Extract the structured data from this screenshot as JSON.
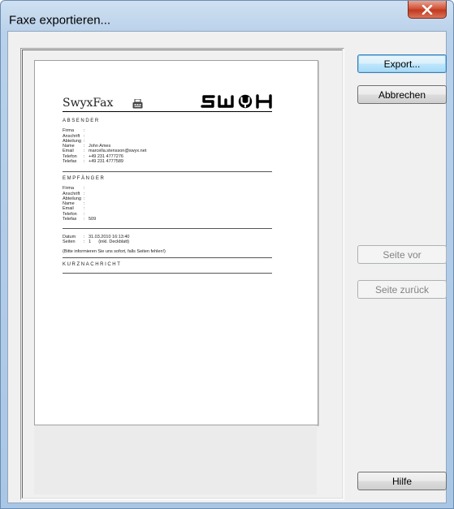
{
  "window": {
    "title": "Faxe exportieren..."
  },
  "buttons": {
    "export": "Export...",
    "cancel": "Abbrechen",
    "next_page": "Seite vor",
    "prev_page": "Seite zurück",
    "help": "Hilfe"
  },
  "document": {
    "brand": "SwyxFax",
    "sender": {
      "title": "ABSENDER",
      "rows": [
        {
          "label": "Firma",
          "value": ""
        },
        {
          "label": "Anschrift",
          "value": ""
        },
        {
          "label": "Abteilung",
          "value": ""
        },
        {
          "label": "Name",
          "value": "John Ames"
        },
        {
          "label": "Email",
          "value": "marcella.stensson@swyx.net"
        },
        {
          "label": "Telefon",
          "value": "+49 231 4777276"
        },
        {
          "label": "Telefax",
          "value": "+49 231 4777589"
        }
      ]
    },
    "recipient": {
      "title": "EMPFÄNGER",
      "rows": [
        {
          "label": "Firma",
          "value": ""
        },
        {
          "label": "Anschrift",
          "value": ""
        },
        {
          "label": "Abteilung",
          "value": ""
        },
        {
          "label": "Name",
          "value": ""
        },
        {
          "label": "Email",
          "value": ""
        },
        {
          "label": "Telefon",
          "value": ""
        },
        {
          "label": "Telefax",
          "value": "509"
        }
      ]
    },
    "meta": {
      "rows": [
        {
          "label": "Datum",
          "value": "31.03.2010 16:13:40"
        },
        {
          "label": "Seiten",
          "value": "1      (inkl. Deckblatt)"
        }
      ],
      "note": "(Bitte informieren Sie uns sofort, falls Seiten fehlen!)"
    },
    "message": {
      "title": "KURZNACHRICHT"
    }
  }
}
